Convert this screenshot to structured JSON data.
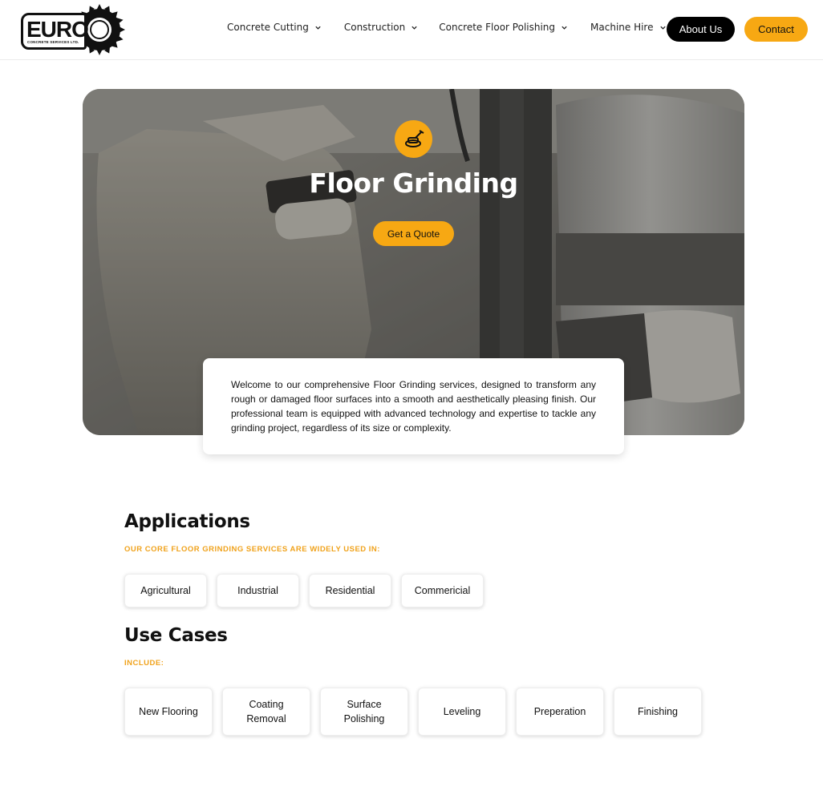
{
  "header": {
    "logo_text": "EURO",
    "logo_sub": "CONCRETE SERVICES LTD.",
    "nav": [
      {
        "label": "Concrete Cutting"
      },
      {
        "label": "Construction"
      },
      {
        "label": "Concrete Floor Polishing"
      },
      {
        "label": "Machine Hire"
      }
    ],
    "about_label": "About Us",
    "contact_label": "Contact"
  },
  "hero": {
    "icon": "floor-grinder-icon",
    "title": "Floor Grinding",
    "cta_label": "Get a Quote",
    "intro": "Welcome to our comprehensive Floor Grinding services, designed to transform any rough or damaged floor surfaces into a smooth and aesthetically pleasing finish. Our professional team is equipped with advanced technology and expertise to tackle any grinding project, regardless of its size or complexity."
  },
  "applications": {
    "title": "Applications",
    "subtitle": "OUR CORE FLOOR GRINDING SERVICES ARE WIDELY USED IN:",
    "items": [
      {
        "label": "Agricultural"
      },
      {
        "label": "Industrial"
      },
      {
        "label": "Residential"
      },
      {
        "label": "Commericial"
      }
    ]
  },
  "use_cases": {
    "title": "Use Cases",
    "subtitle": "INCLUDE:",
    "items": [
      {
        "label": "New Flooring"
      },
      {
        "label": "Coating Removal"
      },
      {
        "label": "Surface Polishing"
      },
      {
        "label": "Leveling"
      },
      {
        "label": "Preperation"
      },
      {
        "label": "Finishing"
      }
    ]
  },
  "colors": {
    "accent": "#f7a813",
    "dark": "#000000"
  }
}
